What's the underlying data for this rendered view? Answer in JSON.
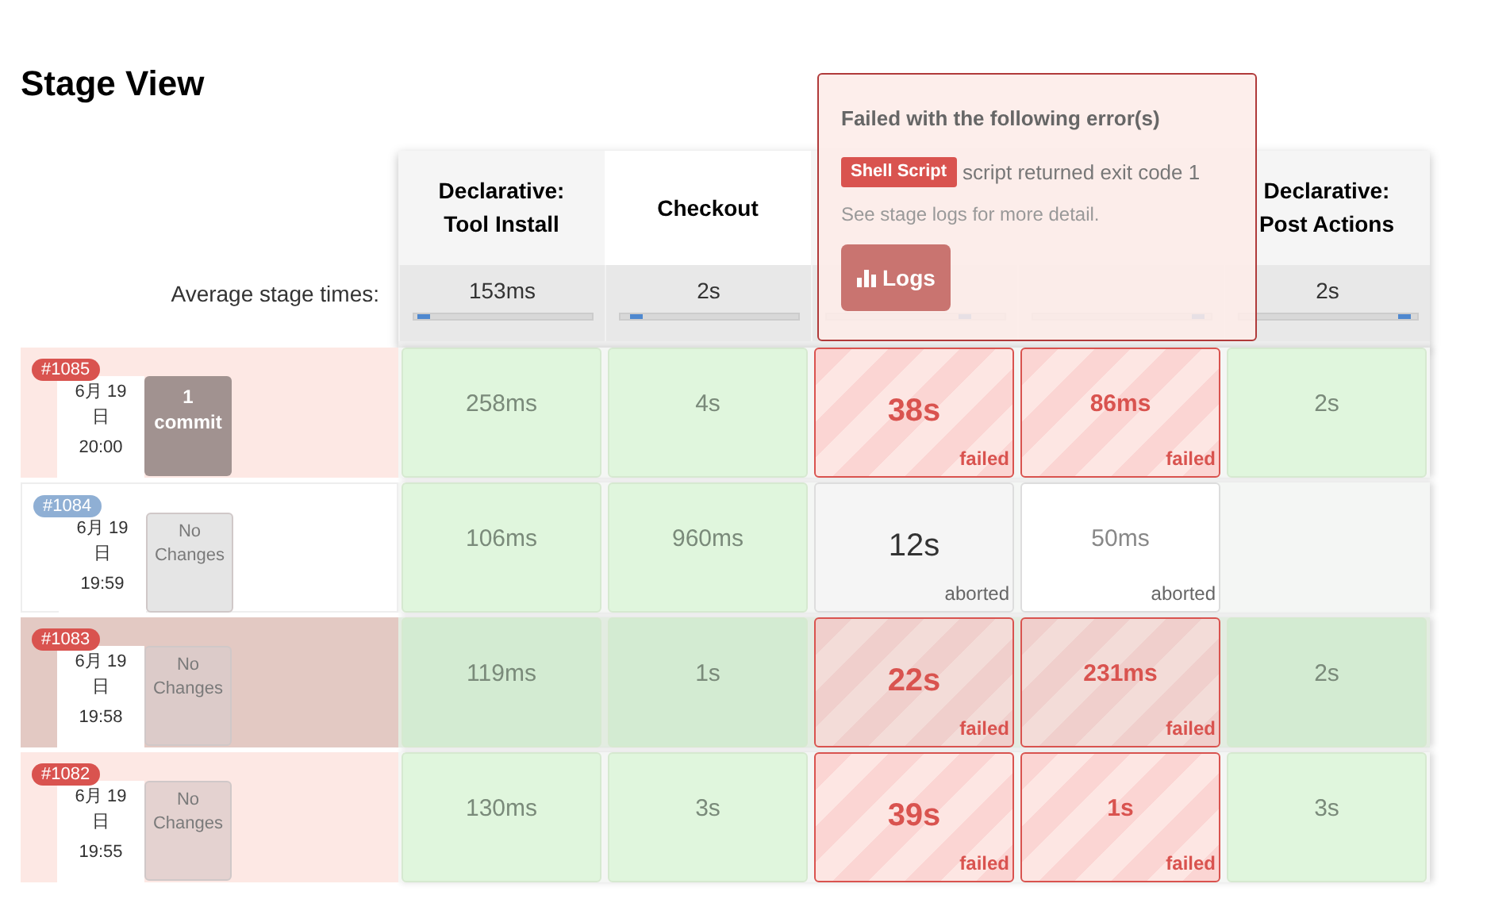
{
  "title": "Stage View",
  "average_label": "Average stage times:",
  "stages": [
    {
      "name": "Declarative: Tool Install",
      "average": "153ms",
      "level": 0.02
    },
    {
      "name": "Checkout",
      "average": "2s",
      "level": 0.06
    },
    {
      "level": 0.8
    },
    {
      "level": 0.97
    },
    {
      "name": "Declarative: Post Actions",
      "average": "2s",
      "level": 0.97
    }
  ],
  "builds": [
    {
      "number": "#1085",
      "kind": "failed",
      "selected": false,
      "date": "6月 19 日",
      "time": "20:00",
      "changes": {
        "kind": "commits",
        "count": "1",
        "label": "commit"
      },
      "cells": [
        {
          "kind": "success",
          "time": "258ms"
        },
        {
          "kind": "success",
          "time": "4s"
        },
        {
          "kind": "failed",
          "time": "38s",
          "label": "failed"
        },
        {
          "kind": "failed",
          "time": "86ms",
          "label": "failed"
        },
        {
          "kind": "success",
          "time": "2s"
        }
      ]
    },
    {
      "number": "#1084",
      "kind": "aborted",
      "selected": false,
      "date": "6月 19 日",
      "time": "19:59",
      "changes": {
        "kind": "none",
        "label": "No Changes"
      },
      "cells": [
        {
          "kind": "success",
          "time": "106ms"
        },
        {
          "kind": "success",
          "time": "960ms"
        },
        {
          "kind": "aborted",
          "time": "12s",
          "label": "aborted"
        },
        {
          "kind": "aborted",
          "time": "50ms",
          "label": "aborted"
        }
      ]
    },
    {
      "number": "#1083",
      "kind": "failed",
      "selected": true,
      "date": "6月 19 日",
      "time": "19:58",
      "changes": {
        "kind": "none",
        "label": "No Changes"
      },
      "cells": [
        {
          "kind": "success",
          "time": "119ms"
        },
        {
          "kind": "success",
          "time": "1s"
        },
        {
          "kind": "failed",
          "time": "22s",
          "label": "failed"
        },
        {
          "kind": "failed",
          "time": "231ms",
          "label": "failed"
        },
        {
          "kind": "success",
          "time": "2s"
        }
      ]
    },
    {
      "number": "#1082",
      "kind": "failed",
      "selected": false,
      "date": "6月 19 日",
      "time": "19:55",
      "changes": {
        "kind": "none",
        "label": "No Changes"
      },
      "cells": [
        {
          "kind": "success",
          "time": "130ms"
        },
        {
          "kind": "success",
          "time": "3s"
        },
        {
          "kind": "failed",
          "time": "39s",
          "label": "failed"
        },
        {
          "kind": "failed",
          "time": "1s",
          "label": "failed"
        },
        {
          "kind": "success",
          "time": "3s"
        }
      ]
    }
  ],
  "popup": {
    "title": "Failed with the following error(s)",
    "tag": "Shell Script",
    "message": "script returned exit code 1",
    "hint": "See stage logs for more detail.",
    "button": "Logs"
  }
}
